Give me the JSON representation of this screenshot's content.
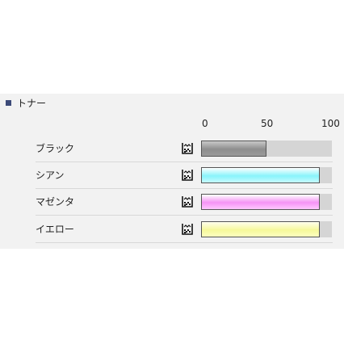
{
  "section": {
    "title": "トナー",
    "marker_color": "#3c4a78"
  },
  "scale": {
    "min": "0",
    "mid": "50",
    "max": "100"
  },
  "toners": [
    {
      "label": "ブラック",
      "level_percent": 50,
      "color_top": "#c8c8c8",
      "color_mid": "#8e8e8e",
      "color_bottom": "#9a9a9a",
      "icon": "toner-icon"
    },
    {
      "label": "シアン",
      "level_percent": 91,
      "color_top": "#ffffff",
      "color_mid": "#88f4fb",
      "color_bottom": "#c8fbff",
      "icon": "toner-icon"
    },
    {
      "label": "マゼンタ",
      "level_percent": 91,
      "color_top": "#ffffff",
      "color_mid": "#f593f5",
      "color_bottom": "#ffc8ff",
      "icon": "toner-icon"
    },
    {
      "label": "イエロー",
      "level_percent": 91,
      "color_top": "#ffffee",
      "color_mid": "#f6f89a",
      "color_bottom": "#fcffc0",
      "icon": "toner-icon"
    }
  ]
}
